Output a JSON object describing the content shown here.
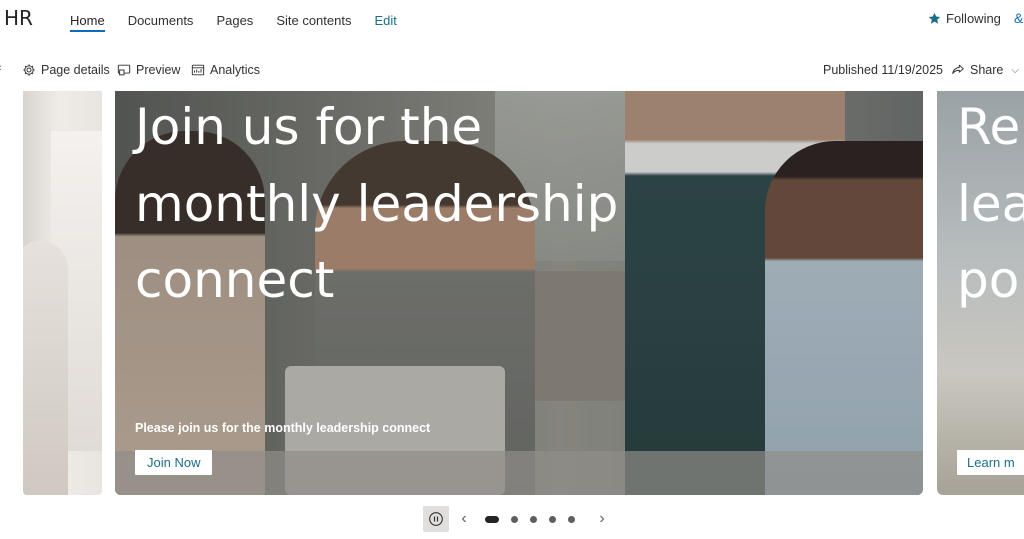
{
  "site": {
    "title": "HR"
  },
  "nav": {
    "items": [
      {
        "label": "Home"
      },
      {
        "label": "Documents"
      },
      {
        "label": "Pages"
      },
      {
        "label": "Site contents"
      },
      {
        "label": "Edit"
      }
    ],
    "following_label": "Following"
  },
  "commandbar": {
    "page_details": "Page details",
    "preview": "Preview",
    "analytics": "Analytics",
    "published": "Published 11/19/2025",
    "share": "Share"
  },
  "carousel": {
    "main": {
      "headline": "Join us for the monthly leadership connect",
      "description": "Please join us for the monthly leadership connect",
      "button": "Join Now"
    },
    "next": {
      "headline_partial": "Re\nlea\npo",
      "button_partial": "Learn m"
    },
    "pager": {
      "prev": "‹",
      "next": "›",
      "dots": 5,
      "active": 0
    }
  },
  "colors": {
    "accent": "#0f6cbd",
    "link_teal": "#1c6e86",
    "text": "#323130"
  }
}
